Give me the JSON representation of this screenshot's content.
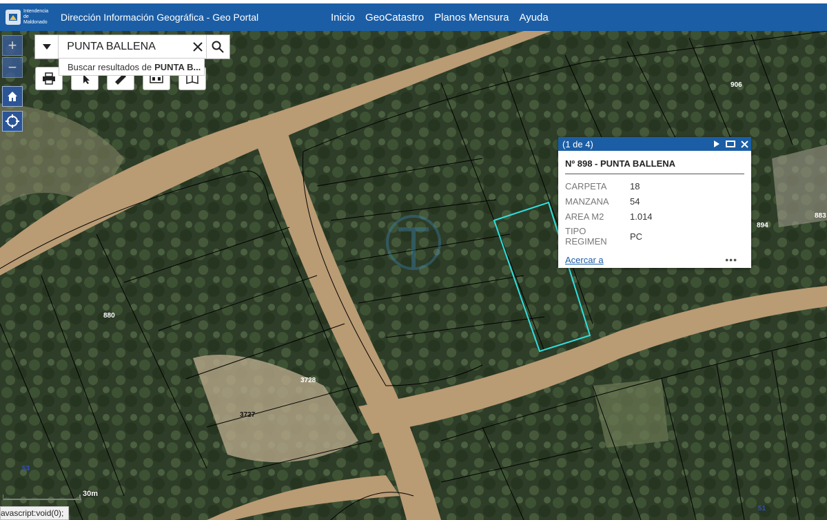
{
  "header": {
    "logo_text": "Intendencia de Maldonado",
    "title": "Dirección Información Geográfica - Geo Portal",
    "nav": [
      "Inicio",
      "GeoCatastro",
      "Planos Mensura",
      "Ayuda"
    ]
  },
  "controls": {
    "zoom_in": "+",
    "zoom_out": "−"
  },
  "search": {
    "value": "PUNTA BALLENA",
    "suggestion_prefix": "Buscar resultados de",
    "suggestion_term": "PUNTA B..."
  },
  "popup": {
    "counter": "(1 de 4)",
    "title": "Nº 898 - PUNTA BALLENA",
    "fields": [
      {
        "label": "CARPETA",
        "value": "18"
      },
      {
        "label": "MANZANA",
        "value": "54"
      },
      {
        "label": "AREA M2",
        "value": "1.014"
      },
      {
        "label": "TIPO REGIMEN",
        "value": "PC"
      }
    ],
    "zoom_link": "Acercar a",
    "more": "•••"
  },
  "parcel_labels": [
    "906",
    "894",
    "883",
    "880",
    "3728",
    "3727",
    "53",
    "51"
  ],
  "scale": {
    "label": "30m"
  },
  "status_bar": "avascript:void(0);",
  "colors": {
    "header_blue": "#1b5ea6",
    "selection_cyan": "#2fe0e0",
    "road": "#b99b74"
  }
}
